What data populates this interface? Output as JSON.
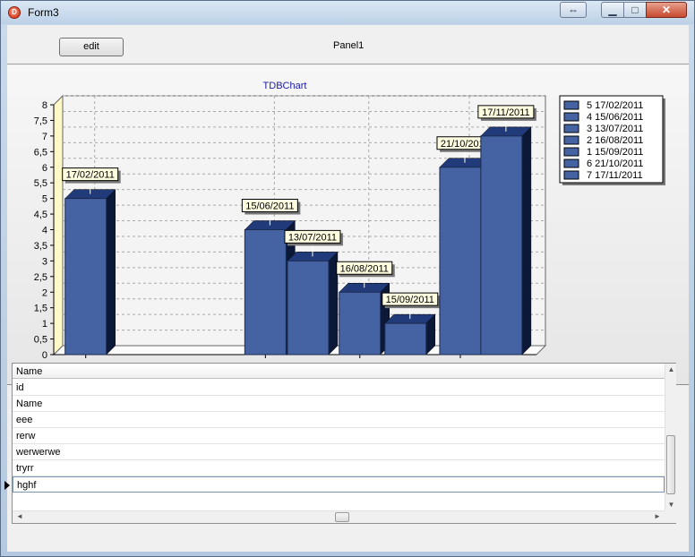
{
  "window": {
    "title": "Form3",
    "app_icon_letter": "D",
    "restore_glyph": "⇔",
    "min_glyph": "▁",
    "max_glyph": "□",
    "close_glyph": "✕"
  },
  "toolbar": {
    "edit_label": "edit",
    "panel_label": "Panel1"
  },
  "chart_data": {
    "type": "bar",
    "title": "TDBChart",
    "xlabel": "",
    "ylabel": "",
    "ylim": [
      0,
      8
    ],
    "y_ticks": [
      "0",
      "0,5",
      "1",
      "1,5",
      "2",
      "2,5",
      "3",
      "3,5",
      "4",
      "4,5",
      "5",
      "5,5",
      "6",
      "6,5",
      "7",
      "7,5",
      "8"
    ],
    "x_tick_labels": [
      "17/02/2011",
      "15/06/2011",
      "16/08/2011",
      "21/10/2011"
    ],
    "x_tick_dates": [
      "2011-02-17",
      "2011-06-15",
      "2011-08-16",
      "2011-10-21"
    ],
    "x_range": [
      "2011-01-27",
      "2011-12-10"
    ],
    "points": [
      {
        "date": "2011-02-17",
        "label": "17/02/2011",
        "value": 5
      },
      {
        "date": "2011-06-15",
        "label": "15/06/2011",
        "value": 4
      },
      {
        "date": "2011-07-13",
        "label": "13/07/2011",
        "value": 3
      },
      {
        "date": "2011-08-16",
        "label": "16/08/2011",
        "value": 2
      },
      {
        "date": "2011-09-15",
        "label": "15/09/2011",
        "value": 1
      },
      {
        "date": "2011-10-21",
        "label": "21/10/2011",
        "value": 6
      },
      {
        "date": "2011-11-17",
        "label": "17/11/2011",
        "value": 7
      }
    ],
    "legend": [
      "5 17/02/2011",
      "4 15/06/2011",
      "3 13/07/2011",
      "2 16/08/2011",
      "1 15/09/2011",
      "6 21/10/2011",
      "7 17/11/2011"
    ],
    "legend_position": "right",
    "grid": true,
    "view": "3d",
    "colors": {
      "bar_front": "#4563a3",
      "bar_top": "#203a7a",
      "bar_side": "#0c1838",
      "title": "#1a1aa0",
      "mark_fill": "#fffde0"
    }
  },
  "grid": {
    "header": "Name",
    "rows": [
      "id",
      "Name",
      "eee",
      "rerw",
      "werwerwe",
      "tryrr",
      "hghf"
    ],
    "selected_index": 6
  },
  "scroll": {
    "up": "▲",
    "down": "▼",
    "left": "◄",
    "right": "►"
  }
}
